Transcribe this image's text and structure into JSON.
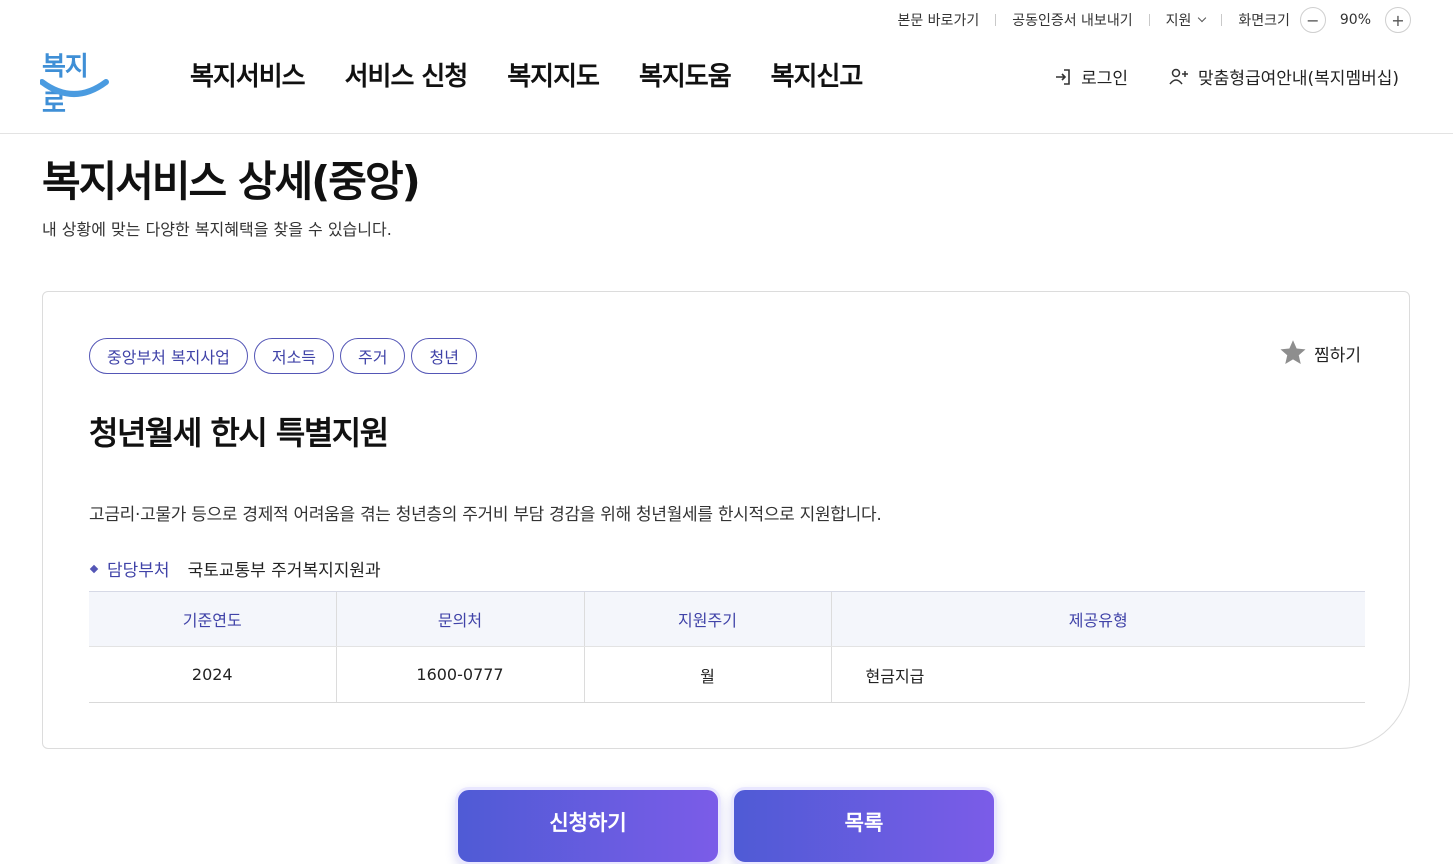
{
  "utility": {
    "skip_to_content": "본문 바로가기",
    "cert_export": "공동인증서 내보내기",
    "support": "지원",
    "screen_size_label": "화면크기",
    "zoom_minus": "−",
    "zoom_value": "90%",
    "zoom_plus": "+"
  },
  "header": {
    "logo_text": "복지로",
    "nav": [
      "복지서비스",
      "서비스 신청",
      "복지지도",
      "복지도움",
      "복지신고"
    ],
    "login": "로그인",
    "membership": "맞춤형급여안내(복지멤버십)"
  },
  "page": {
    "title": "복지서비스 상세(중앙)",
    "subtitle": "내 상황에 맞는 다양한 복지혜택을 찾을 수 있습니다."
  },
  "service": {
    "tags": [
      "중앙부처 복지사업",
      "저소득",
      "주거",
      "청년"
    ],
    "favorite_label": "찜하기",
    "title": "청년월세 한시 특별지원",
    "description": "고금리·고물가 등으로 경제적 어려움을 겪는 청년층의 주거비 부담 경감을 위해 청년월세를 한시적으로 지원합니다.",
    "dept_label": "담당부처",
    "dept_value": "국토교통부 주거복지지원과",
    "table": {
      "headers": [
        "기준연도",
        "문의처",
        "지원주기",
        "제공유형"
      ],
      "row": [
        "2024",
        "1600-0777",
        "월",
        "현금지급"
      ]
    }
  },
  "actions": {
    "apply": "신청하기",
    "list": "목록"
  },
  "colors": {
    "accent": "#4043a8",
    "button_start": "#4f5bd5",
    "button_end": "#7b5ce8",
    "logo_blue": "#3f8fd6"
  }
}
